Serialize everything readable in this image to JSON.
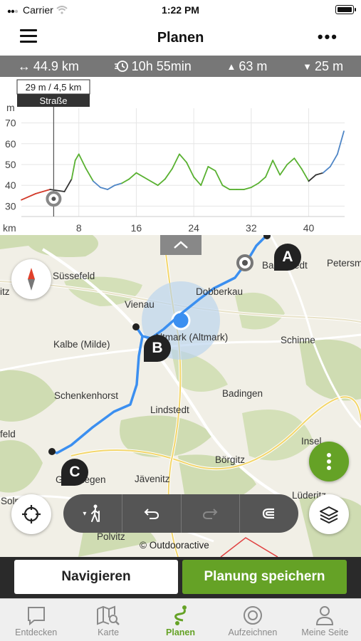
{
  "status_bar": {
    "carrier": "Carrier",
    "time": "1:22 PM"
  },
  "nav": {
    "title": "Planen"
  },
  "stats": {
    "distance": "44.9 km",
    "duration": "10h 55min",
    "ascent": "63 m",
    "descent": "25 m"
  },
  "elevation": {
    "tooltip_value": "29 m / 4,5 km",
    "tooltip_surface": "Straße",
    "y_unit": "m",
    "x_unit": "km",
    "y_ticks": [
      "70",
      "60",
      "50",
      "40",
      "30"
    ],
    "x_ticks": [
      "8",
      "16",
      "24",
      "32",
      "40"
    ]
  },
  "chart_data": {
    "type": "line",
    "title": "",
    "xlabel": "km",
    "ylabel": "m",
    "xlim": [
      0,
      45
    ],
    "ylim": [
      25,
      75
    ],
    "grid": true,
    "series": [
      {
        "x": [
          0,
          2,
          4,
          6,
          7,
          7.5,
          8,
          9,
          10,
          11,
          12,
          13,
          14,
          15,
          16,
          17,
          18,
          19,
          20,
          21,
          22,
          23,
          24,
          25,
          26,
          27,
          28,
          29,
          30,
          31,
          32,
          33,
          34,
          35,
          36,
          37,
          38,
          39,
          40,
          41,
          42,
          43,
          44,
          44.9
        ],
        "y": [
          33,
          36,
          38,
          37,
          43,
          52,
          55,
          48,
          42,
          39,
          38,
          40,
          41,
          43,
          46,
          44,
          42,
          40,
          43,
          48,
          55,
          51,
          44,
          40,
          49,
          47,
          40,
          38,
          38,
          38,
          39,
          41,
          44,
          52,
          45,
          50,
          53,
          48,
          42,
          45,
          46,
          49,
          55,
          66
        ]
      }
    ],
    "surface_colors": {
      "road": "#333333",
      "path": "#59b131",
      "track": "#4f86c6",
      "highlight": "#d23a2a"
    }
  },
  "map": {
    "labels": [
      "Süssefeld",
      "Vienau",
      "Dobberkau",
      "Petersma",
      "Kalbe (Milde)",
      "Schinne",
      "Schenkenhorst",
      "Badingen",
      "Lindstedt",
      "Insel",
      "Börgitz",
      "Jävenitz",
      "Lüderitz",
      "Polvitz",
      "Solp",
      "itz",
      "feld",
      "Ballerstedt",
      "Gardelegen",
      "Altmark (Altmark)"
    ],
    "waypoints": [
      "A",
      "B",
      "C"
    ],
    "copyright": "© Outdooractive"
  },
  "actions": {
    "navigate": "Navigieren",
    "save": "Planung speichern"
  },
  "tabs": [
    {
      "label": "Entdecken",
      "icon": "chat-bubble-icon"
    },
    {
      "label": "Karte",
      "icon": "map-search-icon"
    },
    {
      "label": "Planen",
      "icon": "route-plan-icon"
    },
    {
      "label": "Aufzeichnen",
      "icon": "record-icon"
    },
    {
      "label": "Meine Seite",
      "icon": "profile-icon"
    }
  ],
  "colors": {
    "accent": "#65a226",
    "route": "#3b8ff0",
    "statsbar": "#777777"
  }
}
